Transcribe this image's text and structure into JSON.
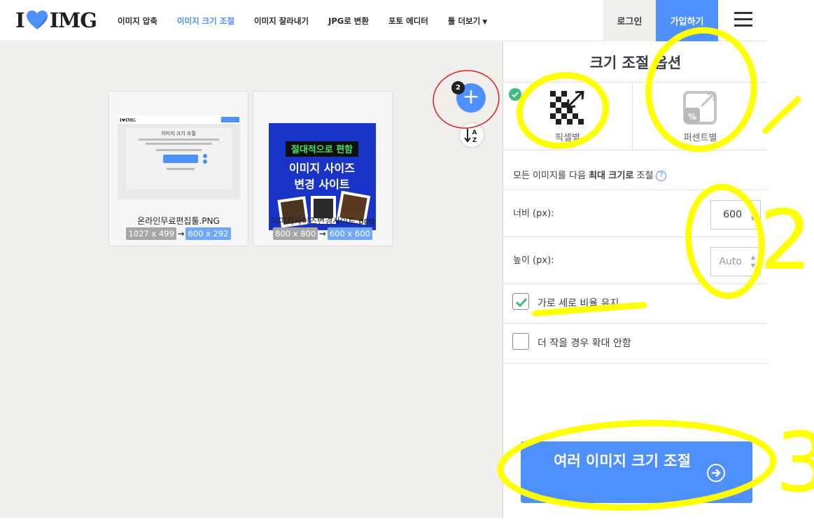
{
  "header": {
    "logo_left": "I",
    "logo_right": "IMG",
    "nav": [
      {
        "label": "이미지 압축"
      },
      {
        "label": "이미지 크기 조절"
      },
      {
        "label": "이미지 잘라내기"
      },
      {
        "label": "JPG로 변환"
      },
      {
        "label": "포토 에디터"
      },
      {
        "label": "툴 더보기"
      }
    ],
    "login": "로그인",
    "signup": "가입하기"
  },
  "workspace": {
    "add_badge": "2",
    "files": [
      {
        "name": "온라인무료편집툴.PNG",
        "original": "1027 x 499",
        "resized": "600 x 292"
      },
      {
        "name": "이미지사이즈변경사이트.png",
        "original": "800 x 800",
        "resized": "600 x 600"
      }
    ],
    "thumb2": {
      "line1": "절대적으로 편함",
      "line2": "이미지 사이즈",
      "line3": "변경 사이트"
    },
    "thumb1": {
      "title": "이미지 크기 조절"
    }
  },
  "sidebar": {
    "title": "크기 조절 옵션",
    "mode_pixel": "픽셀별",
    "mode_percent": "퍼센트별",
    "desc_prefix": "모든 이미지를 다음 ",
    "desc_bold": "최대 크기로",
    "desc_suffix": " 조절",
    "width_label": "너비 (px):",
    "width_value": "600",
    "height_label": "높이 (px):",
    "height_placeholder": "Auto",
    "keep_ratio": "가로 세로 비율 유지",
    "keep_ratio_checked": true,
    "no_enlarge": "더 작을 경우 확대 안함",
    "no_enlarge_checked": false,
    "process_button": "여러 이미지 크기 조절"
  },
  "annotations": {
    "n2": "2",
    "n3": "3"
  },
  "colors": {
    "accent": "#4d90fe",
    "check": "#3dbd7d",
    "highlight": "#ffff00",
    "workspace_bg": "#f1efec"
  }
}
